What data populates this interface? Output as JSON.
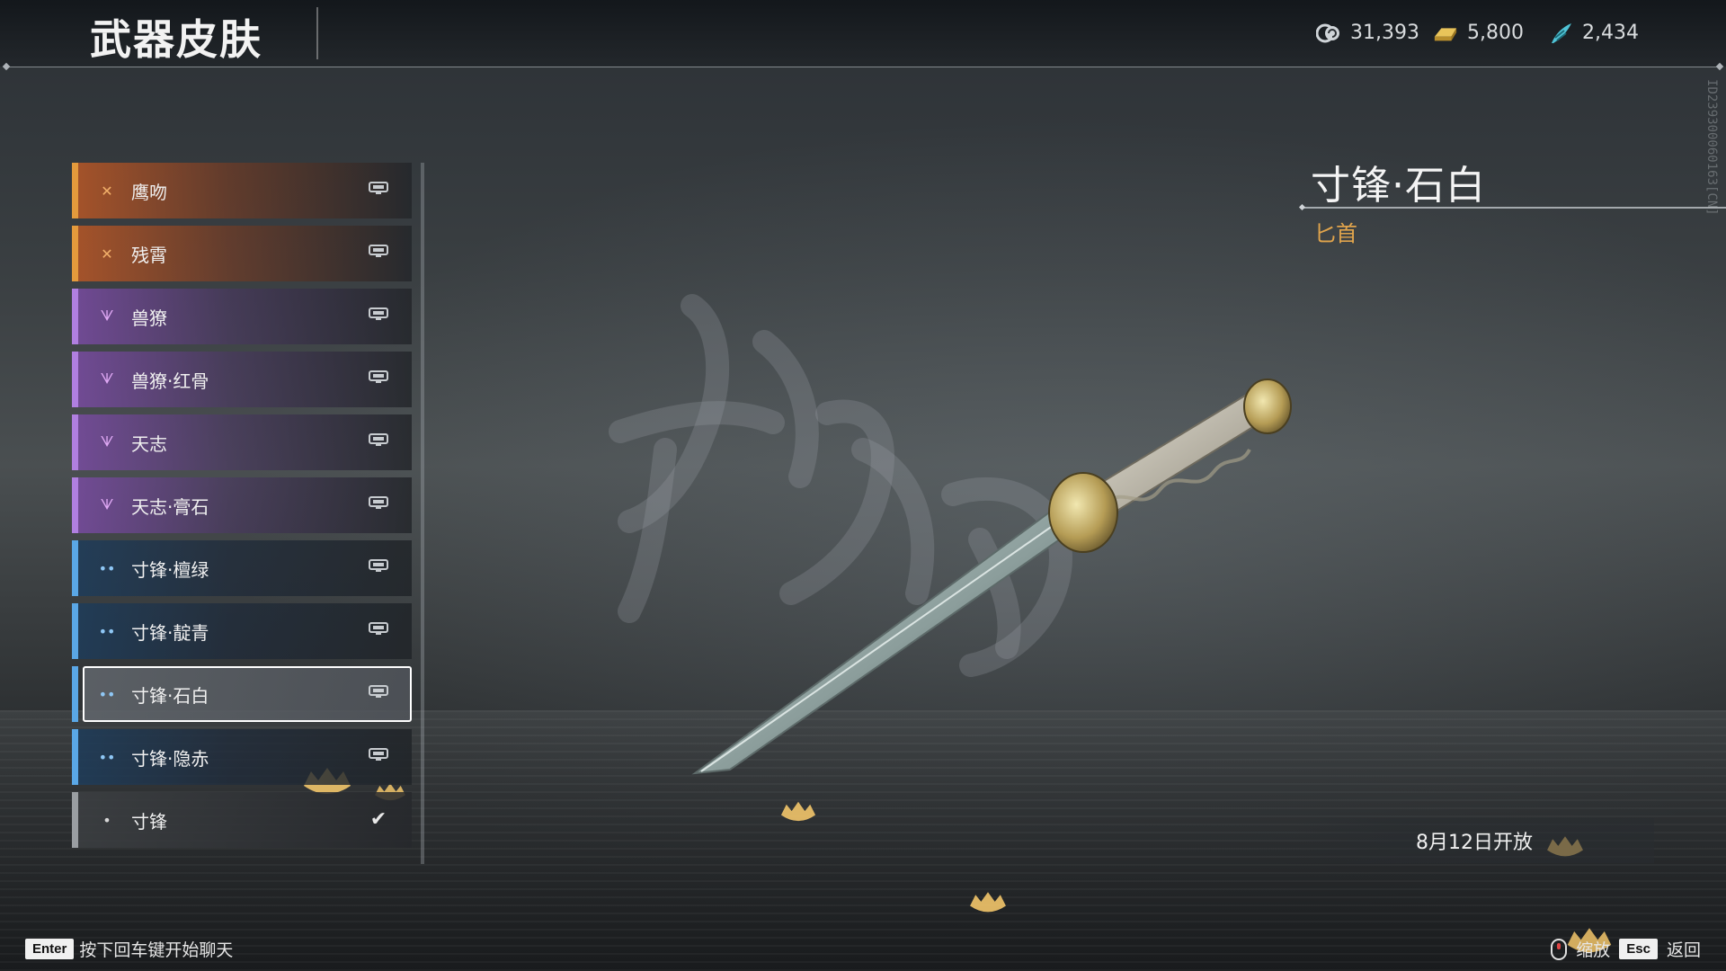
{
  "header": {
    "title": "武器皮肤",
    "currencies": [
      {
        "icon": "coin-swirl-icon",
        "value": "31,393",
        "color": "#cfd4d8"
      },
      {
        "icon": "gold-ingot-icon",
        "value": "5,800",
        "color": "#e9c45a"
      },
      {
        "icon": "jade-feather-icon",
        "value": "2,434",
        "color": "#4fc3d6"
      }
    ]
  },
  "side_id": "ID239300060163[CN]",
  "skins": [
    {
      "label": "鹰吻",
      "rarity": "orange",
      "rarity_glyph": "✕",
      "status": "lock"
    },
    {
      "label": "残霄",
      "rarity": "orange",
      "rarity_glyph": "✕",
      "status": "lock"
    },
    {
      "label": "兽獠",
      "rarity": "purple",
      "rarity_glyph": "ᗐ",
      "status": "lock"
    },
    {
      "label": "兽獠·红骨",
      "rarity": "purple",
      "rarity_glyph": "ᗐ",
      "status": "lock"
    },
    {
      "label": "天志",
      "rarity": "purple",
      "rarity_glyph": "ᗐ",
      "status": "lock"
    },
    {
      "label": "天志·膏石",
      "rarity": "purple",
      "rarity_glyph": "ᗐ",
      "status": "lock"
    },
    {
      "label": "寸锋·檀绿",
      "rarity": "blue",
      "rarity_glyph": "••",
      "status": "lock"
    },
    {
      "label": "寸锋·靛青",
      "rarity": "blue",
      "rarity_glyph": "••",
      "status": "lock"
    },
    {
      "label": "寸锋·石白",
      "rarity": "blue",
      "rarity_glyph": "••",
      "status": "lock",
      "selected": true
    },
    {
      "label": "寸锋·隐赤",
      "rarity": "blue",
      "rarity_glyph": "••",
      "status": "lock"
    },
    {
      "label": "寸锋",
      "rarity": "grey",
      "rarity_glyph": "•",
      "status": "equipped"
    }
  ],
  "detail": {
    "name": "寸锋·石白",
    "type": "匕首",
    "release": "8月12日开放"
  },
  "hints": {
    "chat_key": "Enter",
    "chat_text": "按下回车键开始聊天",
    "zoom_text": "缩放",
    "back_key": "Esc",
    "back_text": "返回"
  }
}
